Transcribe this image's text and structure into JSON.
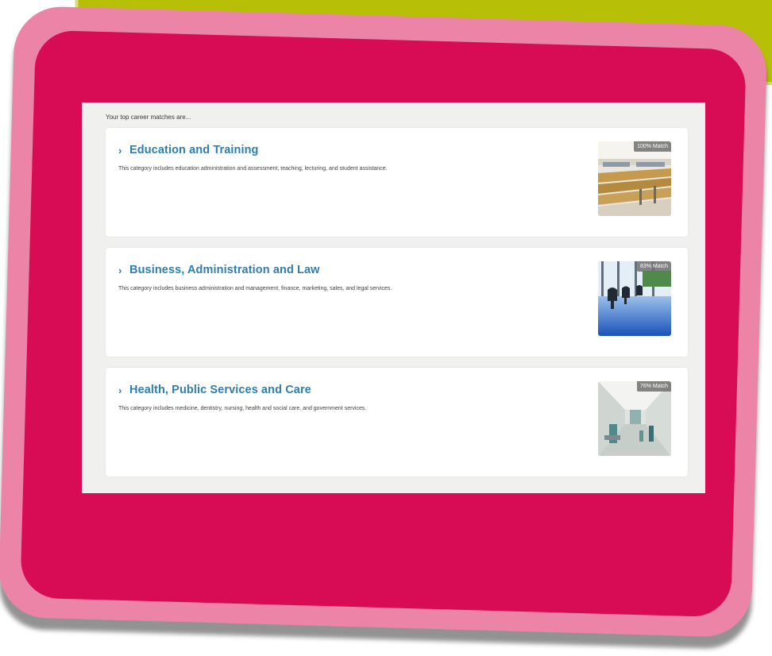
{
  "intro": "Your top career matches are...",
  "careers": [
    {
      "title": "Education and Training",
      "description": "This category includes education administration and assessment, teaching, lecturing, and student assistance.",
      "match": "100% Match",
      "image_icon": "lecture-hall-photo"
    },
    {
      "title": "Business, Administration and Law",
      "description": "This category includes business administration and management, finance, marketing, sales, and legal services.",
      "match": "83% Match",
      "image_icon": "office-chairs-photo"
    },
    {
      "title": "Health, Public Services and Care",
      "description": "This category includes medicine, dentistry, nursing, health and social care, and government services.",
      "match": "76% Match",
      "image_icon": "hospital-corridor-photo"
    }
  ],
  "colors": {
    "title_blue": "#2e7fb0",
    "frame_pink": "#ec84a7",
    "panel_magenta": "#d70c54",
    "banner_lime": "#b7bf06"
  }
}
